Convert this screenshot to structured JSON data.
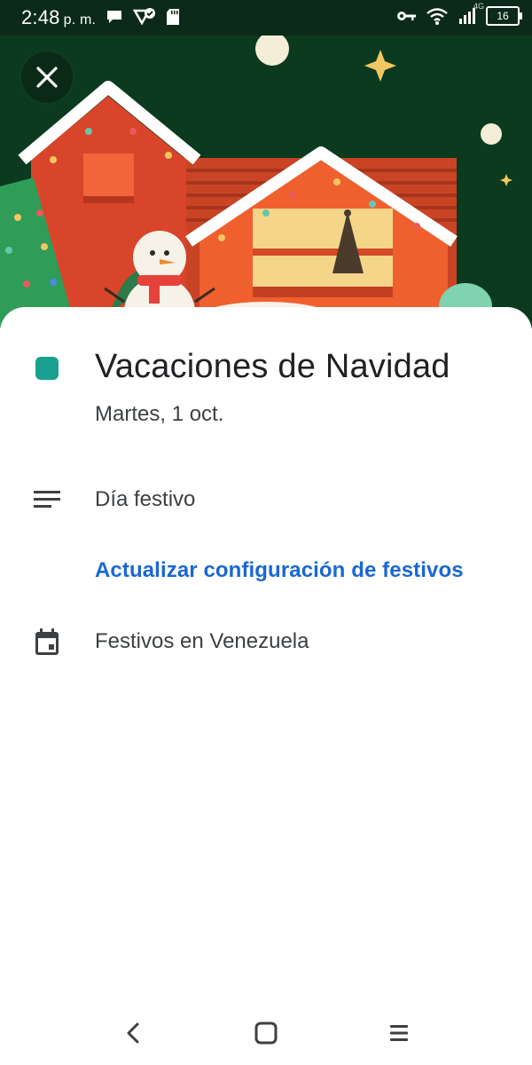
{
  "status_bar": {
    "time": "2:48",
    "ampm": "p. m.",
    "network": "4G",
    "battery": "16"
  },
  "hero": {
    "background": "#0b3a1f",
    "close_icon": "close-icon"
  },
  "event": {
    "title": "Vacaciones de Navidad",
    "date": "Martes, 1 oct.",
    "color": "#1aa191"
  },
  "details": {
    "description": "Día festivo",
    "settings_link": "Actualizar configuración de festivos",
    "calendar": "Festivos en Venezuela"
  },
  "colors": {
    "link": "#1a67d2",
    "text": "#3c4043",
    "title": "#202124"
  },
  "nav_bar": {
    "icons": [
      "back-icon",
      "home-icon",
      "menu-icon"
    ]
  }
}
